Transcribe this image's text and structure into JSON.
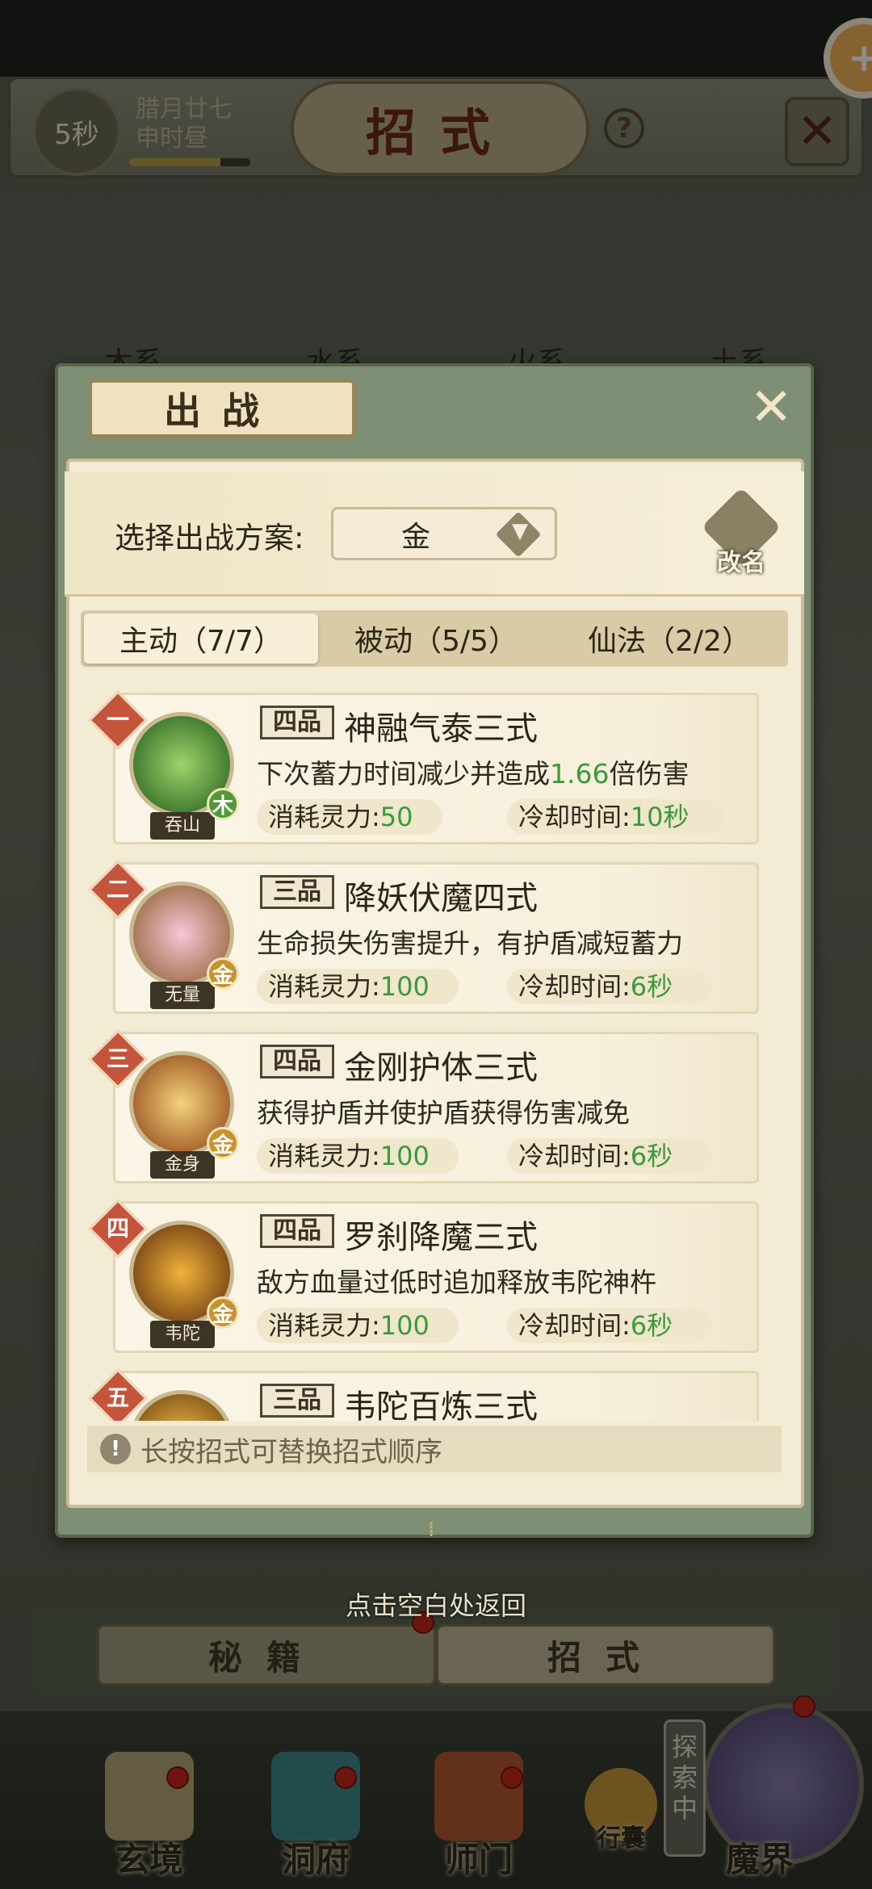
{
  "header": {
    "timer": "5秒",
    "lunar_date": "腊月廿七",
    "lunar_time": "申时昼",
    "timer_progress": 0.75,
    "title": "招式",
    "help": "?",
    "close": "✕",
    "plus": "+"
  },
  "element_tabs": [
    "木系",
    "水系",
    "火系",
    "土系"
  ],
  "modal": {
    "title": "出战",
    "close": "✕",
    "plan_label": "选择出战方案:",
    "plan_value": "金",
    "rename_label": "改名",
    "tabs": [
      "主动（7/7）",
      "被动（5/5）",
      "仙法（2/2）"
    ],
    "skills": [
      {
        "rank": "一",
        "icon_name": "吞山",
        "element": "木",
        "grade": "四品",
        "title": "神融气泰三式",
        "desc_pre": "下次蓄力时间减少并造成",
        "desc_hl": "1.66",
        "desc_post": "倍伤害",
        "cost_label": "消耗灵力:",
        "cost": "50",
        "cd_label": "冷却时间:",
        "cd": "10秒"
      },
      {
        "rank": "二",
        "icon_name": "无量",
        "element": "金",
        "grade": "三品",
        "title": "降妖伏魔四式",
        "desc_pre": "生命损失伤害提升，有护盾减短蓄力",
        "desc_hl": "",
        "desc_post": "",
        "cost_label": "消耗灵力:",
        "cost": "100",
        "cd_label": "冷却时间:",
        "cd": "6秒"
      },
      {
        "rank": "三",
        "icon_name": "金身",
        "element": "金",
        "grade": "四品",
        "title": "金刚护体三式",
        "desc_pre": "获得护盾并使护盾获得伤害减免",
        "desc_hl": "",
        "desc_post": "",
        "cost_label": "消耗灵力:",
        "cost": "100",
        "cd_label": "冷却时间:",
        "cd": "6秒"
      },
      {
        "rank": "四",
        "icon_name": "韦陀",
        "element": "金",
        "grade": "四品",
        "title": "罗刹降魔三式",
        "desc_pre": "敌方血量过低时追加释放韦陀神杵",
        "desc_hl": "",
        "desc_post": "",
        "cost_label": "消耗灵力:",
        "cost": "100",
        "cd_label": "冷却时间:",
        "cd": "6秒"
      },
      {
        "rank": "五",
        "icon_name": "",
        "element": "",
        "grade": "三品",
        "title": "韦陀百炼三式",
        "desc_pre": "",
        "desc_hl": "",
        "desc_post": "",
        "cost_label": "",
        "cost": "",
        "cd_label": "",
        "cd": ""
      }
    ],
    "hint_icon": "!",
    "hint": "长按招式可替换招式顺序"
  },
  "dismiss_hint": "点击空白处返回",
  "bottom_tabs": {
    "secrets": "秘籍",
    "moves": "招式"
  },
  "dock": {
    "xuanjing": "玄境",
    "dongfu": "洞府",
    "shimen": "师门",
    "bag": "行囊",
    "explore": "探索中",
    "demon_realm": "魔界"
  },
  "colors": {
    "accent_green": "#3a9a3a",
    "rank_red": "#c4553c",
    "wood_element": "#4f9a3a",
    "metal_element": "#c8922e"
  }
}
